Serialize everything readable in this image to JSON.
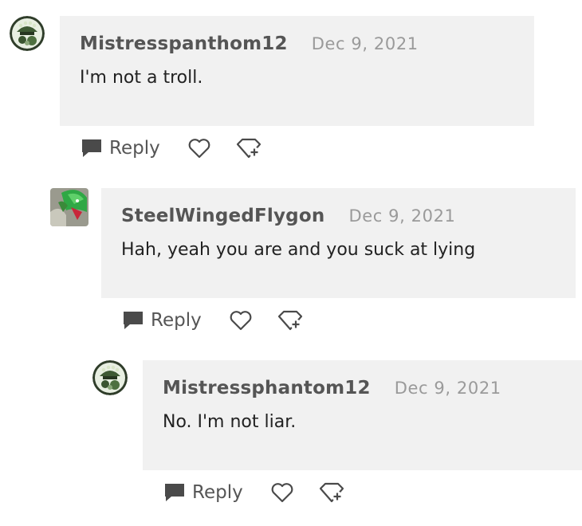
{
  "comments": [
    {
      "username": "Mistresspanthom12",
      "date": "Dec 9, 2021",
      "text": "I'm not a troll.",
      "reply_label": "Reply",
      "avatar_icon": "phantom-avatar-icon"
    },
    {
      "username": "SteelWingedFlygon",
      "date": "Dec 9, 2021",
      "text": "Hah, yeah you are and you suck at lying",
      "reply_label": "Reply",
      "avatar_icon": "flygon-avatar-icon"
    },
    {
      "username": "Mistressphantom12",
      "date": "Dec 9, 2021",
      "text": "No. I'm not liar.",
      "reply_label": "Reply",
      "avatar_icon": "phantom-avatar-icon"
    }
  ],
  "colors": {
    "bubble_bg": "#f1f1f1",
    "username": "#555555",
    "date": "#9a9a9a",
    "icon": "#4a4a4a"
  }
}
